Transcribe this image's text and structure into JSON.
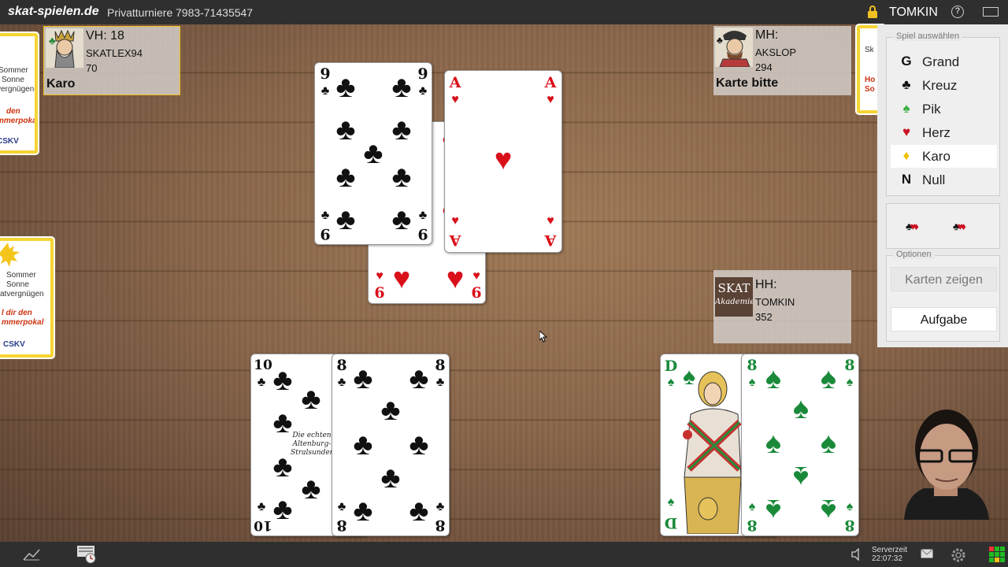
{
  "topbar": {
    "brand": "skat-spielen.de",
    "tournament_label": "Privatturniere",
    "tournament_code": "7983-71435547",
    "username": "TOMKIN"
  },
  "players": {
    "left": {
      "label": "VH: 18",
      "name": "SKATLEX94",
      "score": "70",
      "status": "Karo",
      "avatar": "king-portrait"
    },
    "top": {
      "label": "MH:",
      "name": "AKSLOP",
      "score": "294",
      "status": "Karte bitte",
      "avatar": "jack-portrait"
    },
    "self": {
      "label": "HH:",
      "name": "TOMKIN",
      "score": "352",
      "avatar": "skat-akademie-logo",
      "logo_line1": "SKAT",
      "logo_line2": "Akademie"
    }
  },
  "ads": {
    "top_left": {
      "lines": [
        "Sommer",
        "Sonne",
        "vergnügen",
        "den",
        "mmerpokal",
        "CSKV"
      ]
    },
    "mid_left": {
      "lines": [
        "Sommer",
        "Sonne",
        "atvergnügen",
        "l dir den",
        "mmerpokal",
        "CSKV"
      ]
    },
    "top_right": {
      "lines": [
        "Sk",
        "Ho",
        "So"
      ]
    }
  },
  "table_cards": {
    "trick": [
      {
        "rank": "9",
        "suit": "clubs",
        "color": "black"
      },
      {
        "rank": "A",
        "suit": "hearts",
        "color": "red"
      },
      {
        "rank": "6",
        "suit": "hearts",
        "color": "red"
      }
    ],
    "hand": [
      {
        "rank": "10",
        "suit": "clubs",
        "color": "black",
        "print": "Die echten Altenburg-Stralsunder"
      },
      {
        "rank": "8",
        "suit": "clubs",
        "color": "black"
      },
      {
        "rank": "D",
        "suit": "spades",
        "color": "green"
      },
      {
        "rank": "8",
        "suit": "spades",
        "color": "green"
      }
    ]
  },
  "panel": {
    "choose_legend": "Spiel auswählen",
    "games": [
      {
        "symbol": "G",
        "label": "Grand",
        "color": "#111111",
        "selected": false
      },
      {
        "symbol": "♣",
        "label": "Kreuz",
        "color": "#111111",
        "selected": false
      },
      {
        "symbol": "♠",
        "label": "Pik",
        "color": "#3cb043",
        "selected": false
      },
      {
        "symbol": "♥",
        "label": "Herz",
        "color": "#cc1122",
        "selected": false
      },
      {
        "symbol": "♦",
        "label": "Karo",
        "color": "#f0c000",
        "selected": true
      },
      {
        "symbol": "N",
        "label": "Null",
        "color": "#111111",
        "selected": false
      }
    ],
    "suit_style_icons": [
      "♣♥♦",
      "♣♥♦"
    ],
    "options_legend": "Optionen",
    "show_cards_label": "Karten zeigen",
    "task_label": "Aufgabe"
  },
  "bottombar": {
    "server_time_label": "Serverzeit",
    "server_time": "22:07:32"
  }
}
